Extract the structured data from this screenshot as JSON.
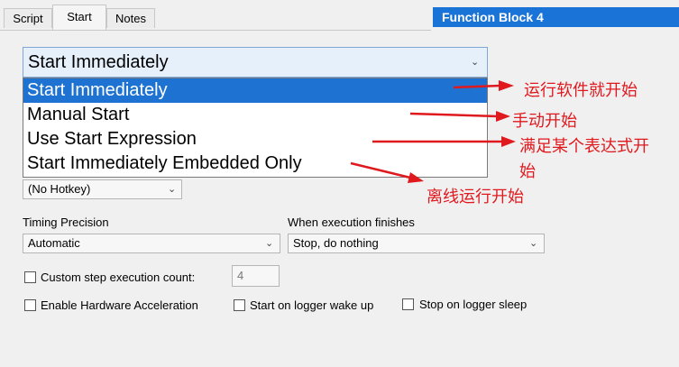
{
  "tabs": [
    {
      "label": "Script"
    },
    {
      "label": "Start"
    },
    {
      "label": "Notes"
    }
  ],
  "block_title": "Function Block 4",
  "start_select": {
    "value": "Start Immediately",
    "options": [
      "Start Immediately",
      "Manual Start",
      "Use Start Expression",
      "Start Immediately Embedded Only"
    ]
  },
  "hotkey": {
    "value": "(No Hotkey)"
  },
  "timing": {
    "label": "Timing Precision",
    "value": "Automatic"
  },
  "finish": {
    "label": "When execution finishes",
    "value": "Stop, do nothing"
  },
  "step_count": {
    "label": "Custom step execution count:",
    "value": "4"
  },
  "checkboxes": [
    {
      "label": "Enable Hardware Acceleration"
    },
    {
      "label": "Start on logger wake up"
    },
    {
      "label": "Stop on logger sleep"
    }
  ],
  "annotations": [
    "运行软件就开始",
    "手动开始",
    "满足某个表达式开",
    "始",
    "离线运行开始"
  ],
  "colors": {
    "accent": "#1e73d2",
    "annotation": "#e0191e"
  }
}
